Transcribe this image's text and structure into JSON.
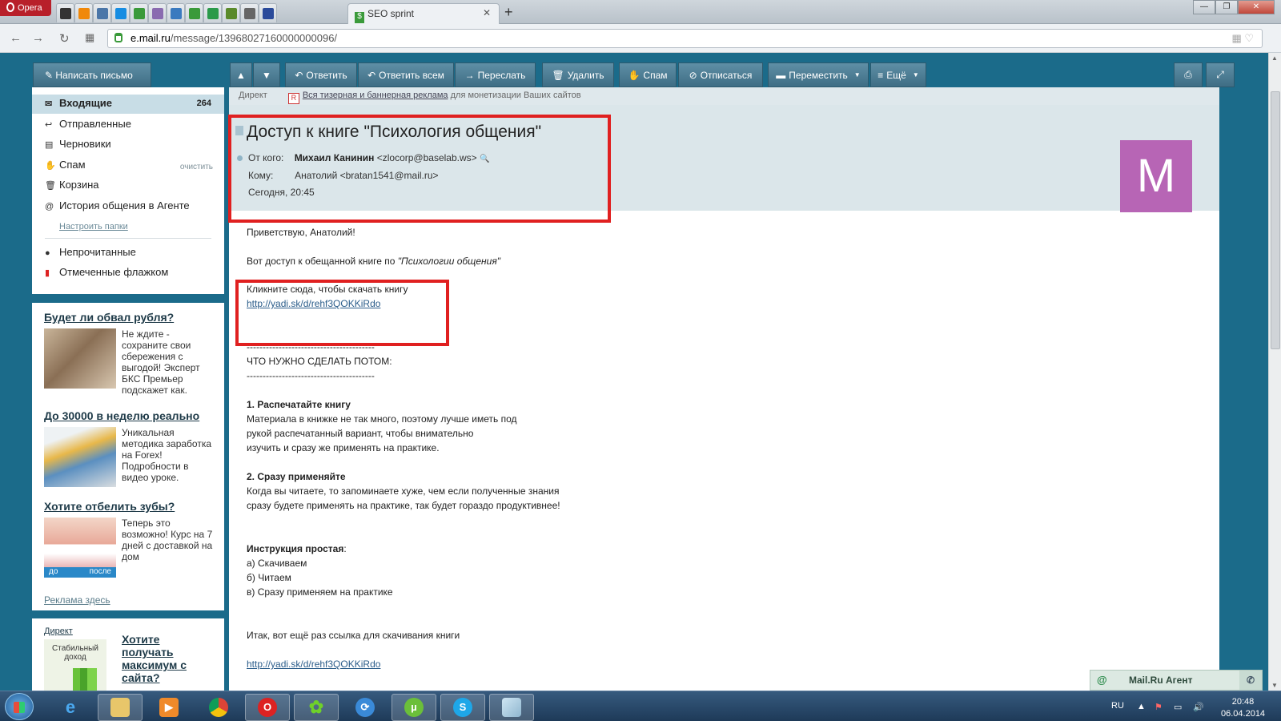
{
  "browser": {
    "brand": "Opera",
    "tab_icons": [
      {
        "icon": "music-icon",
        "color": "#333"
      },
      {
        "icon": "odnoklassniki-icon",
        "color": "#f0880a"
      },
      {
        "icon": "vkontakte-icon",
        "color": "#4a76a8"
      },
      {
        "icon": "mailru-at-icon",
        "color": "#168de2"
      },
      {
        "icon": "mail-envelope-icon",
        "color": "#3a9a3a"
      },
      {
        "icon": "eye-icon",
        "color": "#8a6bb0"
      },
      {
        "icon": "chart-icon",
        "color": "#3a7abf"
      },
      {
        "icon": "seo-sprint-icon",
        "color": "#3a9a3a"
      },
      {
        "icon": "globe-icon",
        "color": "#2a9a4a"
      },
      {
        "icon": "counter-icon",
        "color": "#5a8a2a"
      },
      {
        "icon": "speed-icon",
        "color": "#666"
      },
      {
        "icon": "arrow-a-icon",
        "color": "#2a4a9a"
      }
    ],
    "active_tab": "SEO sprint",
    "url_domain": "e.mail.ru",
    "url_path": "/message/13968027160000000096/"
  },
  "left": {
    "compose": "Написать письмо",
    "folders": [
      {
        "label": "Входящие",
        "icon": "inbox-icon",
        "count": "264"
      },
      {
        "label": "Отправленные",
        "icon": "sent-icon"
      },
      {
        "label": "Черновики",
        "icon": "drafts-icon"
      },
      {
        "label": "Спам",
        "icon": "spam-icon",
        "action": "очистить"
      },
      {
        "label": "Корзина",
        "icon": "trash-icon"
      },
      {
        "label": "История общения в Агенте",
        "icon": "agent-history-icon"
      }
    ],
    "configure": "Настроить папки",
    "filters": [
      {
        "label": "Непрочитанные",
        "icon": "unread-dot-icon"
      },
      {
        "label": "Отмеченные флажком",
        "icon": "flag-icon"
      }
    ]
  },
  "ads": [
    {
      "title": "Будет ли обвал рубля?",
      "text": "Не ждите - сохраните свои сбережения с выгодой! Эксперт БКС Премьер подскажет как.",
      "image": "banknotes-image"
    },
    {
      "title": "До 30000 в неделю реально",
      "text": "Уникальная методика заработка на Forex! Подробности в видео уроке.",
      "image": "credit-cards-image"
    },
    {
      "title": "Хотите отбелить зубы?",
      "text": "Теперь это возможно! Курс на 7 дней с доставкой на дом",
      "image": "teeth-image",
      "img_left": "до",
      "img_right": "после"
    }
  ],
  "ads_link": "Реклама здесь",
  "direct": {
    "label": "Директ",
    "img_text": "Стабильный доход",
    "title": "Хотите получать максимум с сайта?"
  },
  "toolbar": {
    "reply": "Ответить",
    "reply_all": "Ответить всем",
    "forward": "Переслать",
    "delete": "Удалить",
    "spam": "Спам",
    "unsubscribe": "Отписаться",
    "move": "Переместить",
    "more": "Ещё"
  },
  "ad_strip": {
    "label": "Директ",
    "link": "Вся тизерная и баннерная реклама",
    "text": "для монетизации Ваших сайтов"
  },
  "message": {
    "subject": "Доступ к книге \"Психология общения\"",
    "from_label": "От кого:",
    "from_name": "Михаил Канинин",
    "from_email": "<zlocorp@baselab.ws>",
    "to_label": "Кому:",
    "to": "Анатолий <bratan1541@mail.ru>",
    "date": "Сегодня, 20:45",
    "avatar_letter": "М",
    "avatar_color": "#b765b5",
    "greeting": "Приветствую, Анатолий!",
    "intro": "Вот доступ к обещанной книге по",
    "intro_italic": "\"Психологии общения\"",
    "click_text": "Кликните сюда, чтобы скачать книгу",
    "link": "http://yadi.sk/d/rehf3QOKKiRdo",
    "separator": "----------------------------------------",
    "todo": "ЧТО НУЖНО СДЕЛАТЬ ПОТОМ:",
    "step1_title": "1. Распечатайте книгу",
    "step1_lines": [
      "Материала в книжке не так много, поэтому лучше иметь под",
      "рукой распечатанный вариант, чтобы внимательно",
      "изучить и сразу же применять на практике."
    ],
    "step2_title": "2. Сразу применяйте",
    "step2_lines": [
      "Когда вы читаете, то запоминаете хуже, чем если полученные знания",
      "сразу будете применять на практике, так будет гораздо продуктивнее!"
    ],
    "instr_title": "Инструкция простая",
    "instr_items": [
      "а) Скачиваем",
      "б) Читаем",
      "в) Сразу применяем на практике"
    ],
    "outro": "Итак, вот ещё раз ссылка для скачивания книги"
  },
  "agent": "Mail.Ru Агент",
  "taskbar": {
    "lang": "RU",
    "time": "20:48",
    "date": "06.04.2014"
  }
}
